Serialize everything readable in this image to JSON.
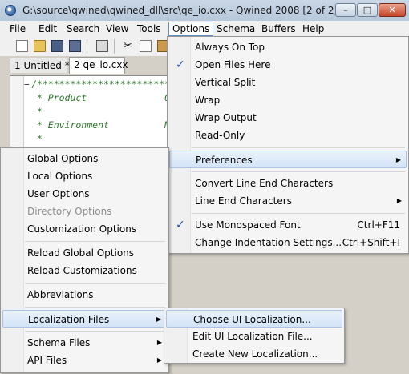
{
  "window": {
    "title": "G:\\source\\qwined\\qwined_dll\\src\\qe_io.cxx - Qwined 2008 [2 of 2]",
    "minimize_icon": "minimize-icon",
    "maximize_icon": "maximize-icon",
    "close_icon": "close-icon"
  },
  "menubar": [
    "File",
    "Edit",
    "Search",
    "View",
    "Tools",
    "Options",
    "Schema",
    "Buffers",
    "Help"
  ],
  "toolbar": {
    "icons": [
      "new-file-icon",
      "open-folder-icon",
      "save-icon",
      "save-all-icon",
      "print-icon",
      "cut-icon",
      "copy-icon",
      "paste-icon"
    ]
  },
  "tabs": [
    {
      "label": "1 Untitled *"
    },
    {
      "label": "2 qe_io.cxx"
    }
  ],
  "editor": {
    "fold_marker": "−",
    "lines": [
      "/***************************",
      " * Product              QW",
      " *",
      " * Environment          Mi",
      " *"
    ]
  },
  "options_menu": {
    "items": [
      {
        "label": "Always On Top"
      },
      {
        "label": "Open Files Here",
        "checked": true
      },
      {
        "label": "Vertical Split"
      },
      {
        "label": "Wrap"
      },
      {
        "label": "Wrap Output"
      },
      {
        "label": "Read-Only"
      },
      {
        "label": "Preferences",
        "submenu": true,
        "highlighted": true
      },
      {
        "label": "Convert Line End Characters"
      },
      {
        "label": "Line End Characters",
        "submenu": true
      },
      {
        "label": "Use Monospaced Font",
        "shortcut": "Ctrl+F11",
        "checked": true
      },
      {
        "label": "Change Indentation Settings...",
        "shortcut": "Ctrl+Shift+I"
      }
    ]
  },
  "preferences_menu": {
    "items": [
      {
        "label": "Global Options"
      },
      {
        "label": "Local Options"
      },
      {
        "label": "User Options"
      },
      {
        "label": "Directory Options",
        "disabled": true
      },
      {
        "label": "Customization Options"
      },
      {
        "label": "Reload Global Options"
      },
      {
        "label": "Reload Customizations"
      },
      {
        "label": "Abbreviations"
      },
      {
        "label": "Localization Files",
        "submenu": true,
        "highlighted": true
      },
      {
        "label": "Schema Files",
        "submenu": true
      },
      {
        "label": "API Files",
        "submenu": true
      }
    ]
  },
  "localization_menu": {
    "items": [
      {
        "label": "Choose UI Localization...",
        "highlighted": true
      },
      {
        "label": "Edit UI Localization File..."
      },
      {
        "label": "Create New Localization..."
      }
    ]
  },
  "glyphs": {
    "check": "✓",
    "arrow": "▶"
  }
}
